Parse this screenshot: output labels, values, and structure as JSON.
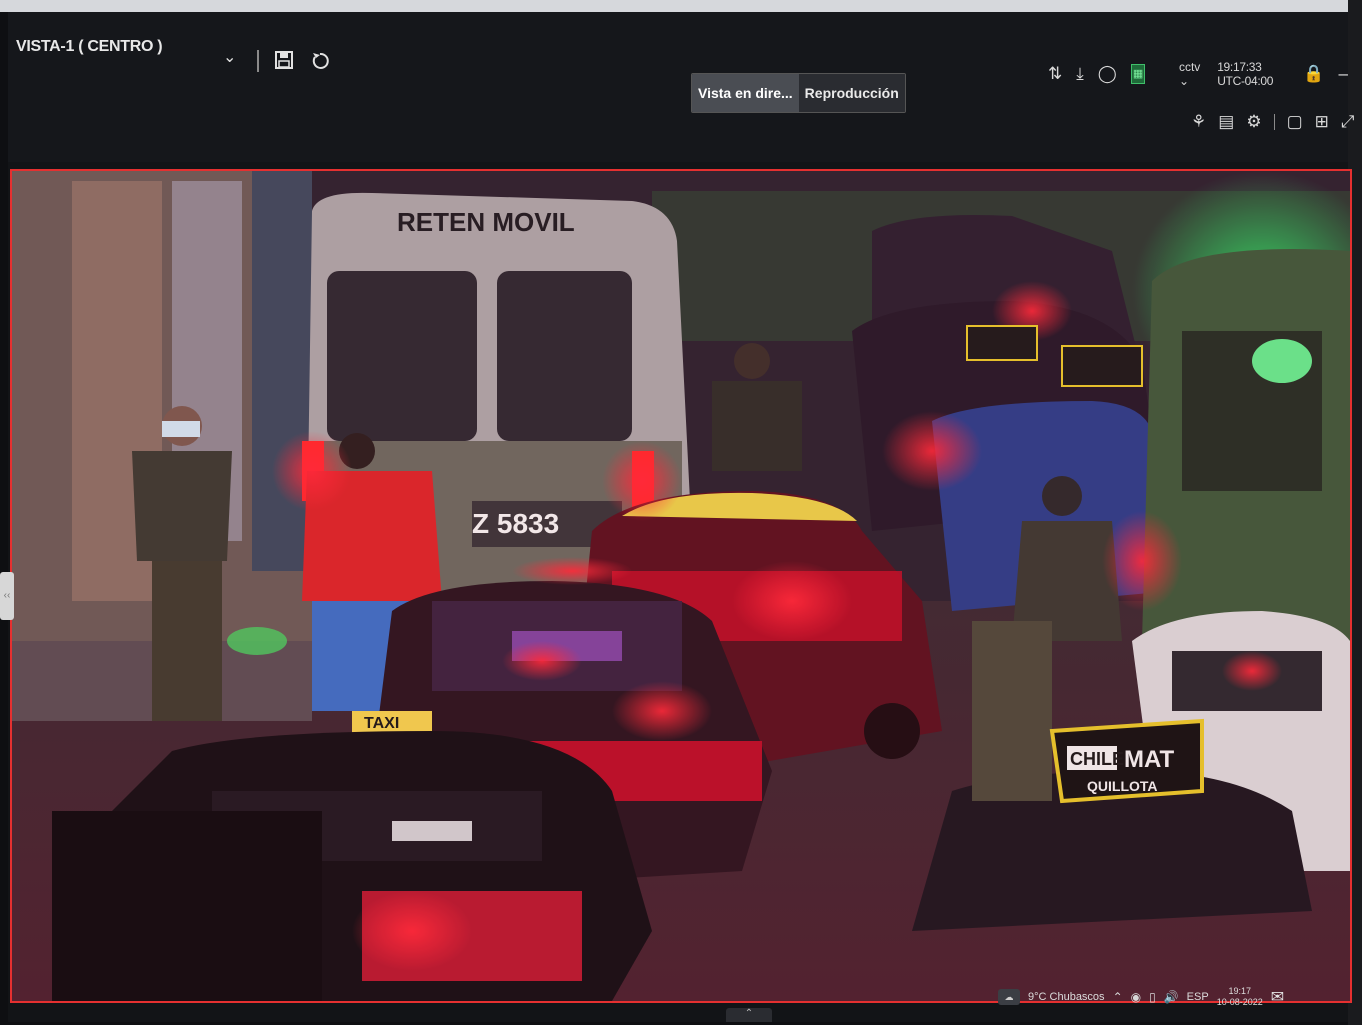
{
  "window": {
    "view_title": "VISTA-1 ( CENTRO )"
  },
  "toolbar_left": {
    "dropdown_icon": "chevron-down-icon",
    "save_icon": "save-icon",
    "refresh_icon": "refresh-icon"
  },
  "mode_switch": {
    "live_label": "Vista en dire...",
    "playback_label": "Reproducción"
  },
  "toolbar_right": {
    "user_label": "cctv",
    "clock": "19:17:33 UTC-04:00"
  },
  "camera_feed": {
    "border_color": "#e53030",
    "van_text": "RETEN MOVIL",
    "plate_text": "Z 5833",
    "taxi_sign": "TAXI",
    "ad_sign_line1": "CHILE",
    "ad_sign_line2": "MAT",
    "ad_sign_line3": "QUILLOTA"
  },
  "taskbar": {
    "weather": "9°C Chubascos",
    "language": "ESP",
    "time": "19:17",
    "date": "10-08-2022"
  },
  "colors": {
    "accent_red": "#e53030",
    "status_green": "#3fbf6a"
  }
}
